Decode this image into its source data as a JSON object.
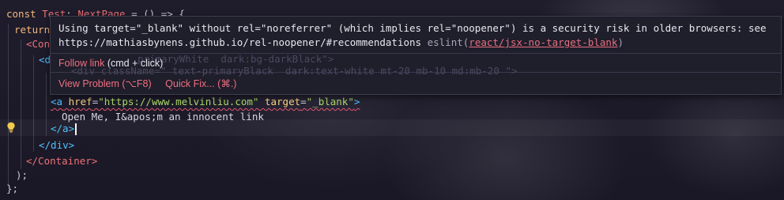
{
  "code": {
    "line1": {
      "kw": "const",
      "name": "Test",
      "colon": ":",
      "type": "NextPage",
      "rest": " = () => {"
    },
    "line2": {
      "kw": "return"
    },
    "line3": {
      "partial": "<Con"
    },
    "line4": {
      "partial": "<di"
    },
    "line7": {
      "open": "<a",
      "attr1": "href",
      "eq1": "=",
      "val1": "\"https://www.melvinliu.com\"",
      "attr2": "target",
      "eq2": "=",
      "val2": "\"_blank\"",
      "close": ">"
    },
    "line8": {
      "text": "Open Me, I&apos;m an innocent link"
    },
    "line9": {
      "tag": "</a>"
    },
    "line10": {
      "tag": "</div>"
    },
    "line11": {
      "tag": "</Container>"
    },
    "line12": {
      "text": ");"
    },
    "line13": {
      "text": "};"
    },
    "behind1": "primaryWhite  dark:bg-darkBlack\">",
    "behind2": "<div className=\" text-primaryBlack  dark:text-white mt-20 mb-10 md:mb-20 \">"
  },
  "hover": {
    "message_line1": "Using target=\"_blank\" without rel=\"noreferrer\" (which implies rel=\"noopener\") is a security risk in older browsers: see",
    "message_line2": "https://mathiasbynens.github.io/rel-noopener/#recommendations",
    "source": "eslint(",
    "rule": "react/jsx-no-target-blank",
    "source_close": ")",
    "follow_link": "Follow link",
    "follow_hint": "(cmd + click)",
    "view_problem": "View Problem (⌥F8)",
    "quick_fix": "Quick Fix... (⌘.)"
  },
  "icons": {
    "bulb": "lightbulb-icon"
  }
}
